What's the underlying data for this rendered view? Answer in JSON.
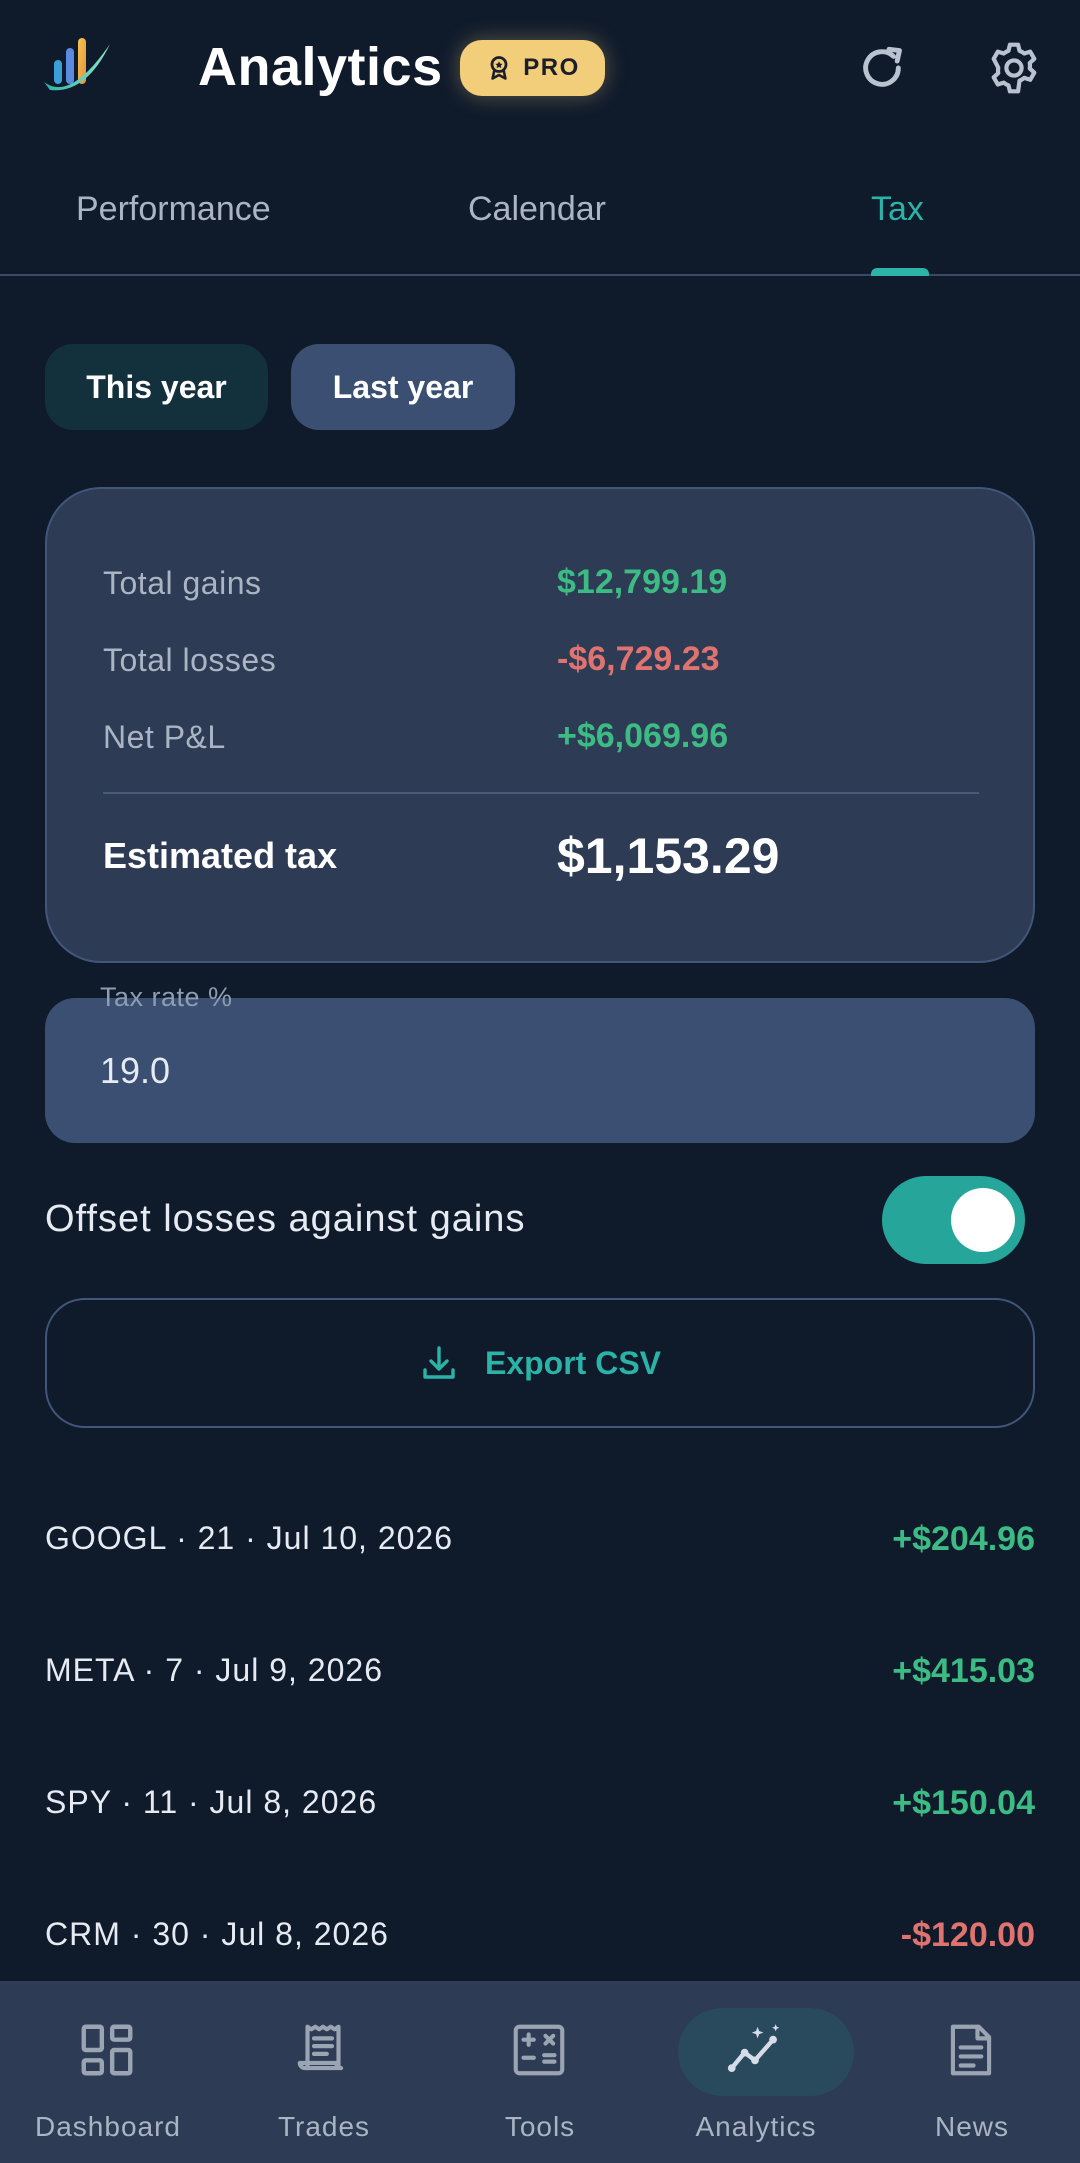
{
  "header": {
    "title": "Analytics",
    "badge": "PRO"
  },
  "tabs": [
    {
      "label": "Performance",
      "active": false
    },
    {
      "label": "Calendar",
      "active": false
    },
    {
      "label": "Tax",
      "active": true
    }
  ],
  "year_filter": {
    "options": [
      "This year",
      "Last year"
    ]
  },
  "summary": {
    "total_gains_label": "Total gains",
    "total_gains": "$12,799.19",
    "total_losses_label": "Total losses",
    "total_losses": "-$6,729.23",
    "net_label": "Net P&L",
    "net": "+$6,069.96",
    "estimated_tax_label": "Estimated tax",
    "estimated_tax": "$1,153.29"
  },
  "tax_rate": {
    "label": "Tax rate %",
    "value": "19.0"
  },
  "offset": {
    "label": "Offset losses against gains",
    "enabled": true
  },
  "export": {
    "label": "Export CSV"
  },
  "trades": [
    {
      "desc": "GOOGL · 21 · Jul 10, 2026",
      "amount": "+$204.96",
      "positive": true
    },
    {
      "desc": "META · 7 · Jul 9, 2026",
      "amount": "+$415.03",
      "positive": true
    },
    {
      "desc": "SPY · 11 · Jul 8, 2026",
      "amount": "+$150.04",
      "positive": true
    },
    {
      "desc": "CRM · 30 · Jul 8, 2026",
      "amount": "-$120.00",
      "positive": false
    }
  ],
  "nav": [
    {
      "label": "Dashboard",
      "icon": "dashboard-icon"
    },
    {
      "label": "Trades",
      "icon": "receipt-icon"
    },
    {
      "label": "Tools",
      "icon": "calculator-icon"
    },
    {
      "label": "Analytics",
      "icon": "analytics-icon",
      "active": true
    },
    {
      "label": "News",
      "icon": "news-icon"
    }
  ],
  "colors": {
    "background": "#0f1a2b",
    "accent": "#2bb3a8",
    "gain": "#3dbb85",
    "loss": "#e0736f",
    "badge": "#f2cd7a"
  }
}
